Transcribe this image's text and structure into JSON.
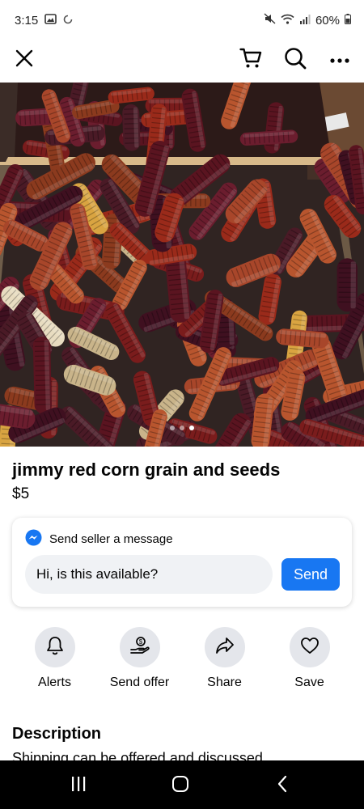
{
  "status_bar": {
    "time": "3:15",
    "battery": "60%"
  },
  "listing": {
    "title": "jimmy red corn grain and seeds",
    "price": "$5",
    "photo_count": 3,
    "active_photo": 3
  },
  "message_card": {
    "heading": "Send seller a message",
    "input_value": "Hi, is this available?",
    "send_label": "Send"
  },
  "actions": [
    {
      "label": "Alerts",
      "icon": "bell-icon"
    },
    {
      "label": "Send offer",
      "icon": "offer-icon"
    },
    {
      "label": "Share",
      "icon": "share-icon"
    },
    {
      "label": "Save",
      "icon": "heart-icon"
    }
  ],
  "description": {
    "heading": "Description",
    "text": "Shipping can be offered and discussed"
  },
  "colors": {
    "accent": "#1877f2",
    "corn_dark": "#5a1420",
    "corn_red": "#9a2a1a",
    "crate": "#d8b98a"
  }
}
